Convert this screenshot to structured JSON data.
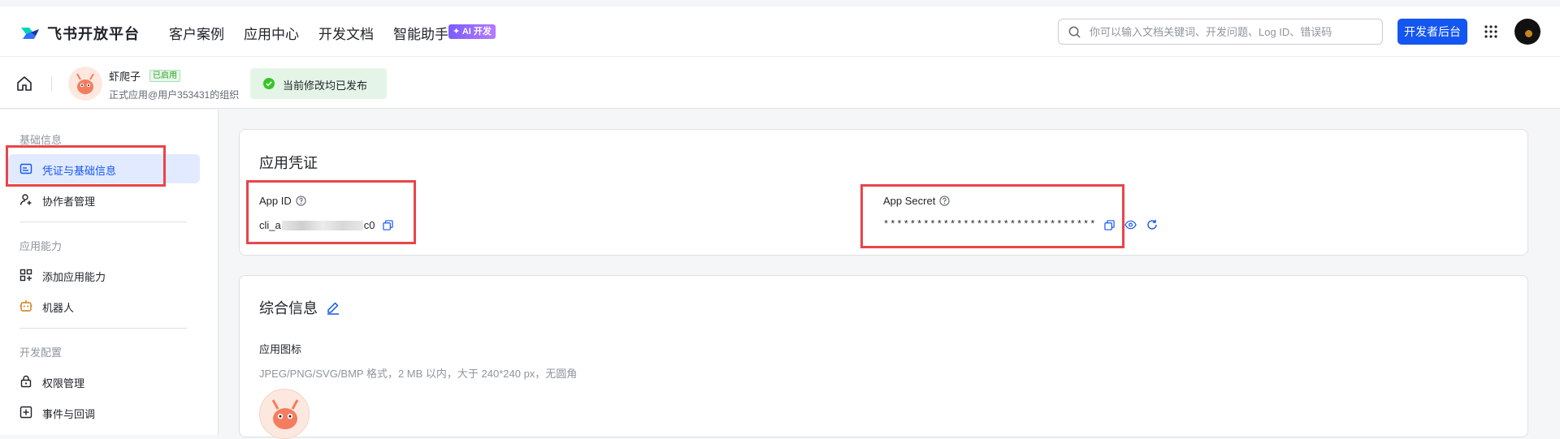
{
  "brand": {
    "name": "飞书开放平台"
  },
  "nav": {
    "items": [
      "客户案例",
      "应用中心",
      "开发文档",
      "智能助手"
    ],
    "ai_badge": "✦ AI 开发"
  },
  "search": {
    "placeholder": "你可以输入文档关键词、开发问题、Log ID、错误码",
    "value": ""
  },
  "dev_console_button": "开发者后台",
  "app": {
    "name": "虾爬子",
    "status_tag": "已启用",
    "org": "正式应用@用户353431的组织"
  },
  "publish_status": "当前修改均已发布",
  "sidebar": {
    "groups": [
      {
        "label": "基础信息",
        "items": [
          {
            "label": "凭证与基础信息",
            "icon": "id-card-icon",
            "active": true
          },
          {
            "label": "协作者管理",
            "icon": "user-add-icon",
            "active": false
          }
        ]
      },
      {
        "label": "应用能力",
        "items": [
          {
            "label": "添加应用能力",
            "icon": "grid-add-icon",
            "active": false
          },
          {
            "label": "机器人",
            "icon": "robot-icon",
            "active": false
          }
        ]
      },
      {
        "label": "开发配置",
        "items": [
          {
            "label": "权限管理",
            "icon": "lock-icon",
            "active": false
          },
          {
            "label": "事件与回调",
            "icon": "event-icon",
            "active": false
          }
        ]
      }
    ]
  },
  "credentials": {
    "title": "应用凭证",
    "app_id": {
      "label": "App ID",
      "prefix": "cli_a",
      "suffix": "c0"
    },
    "app_secret": {
      "label": "App Secret",
      "value": "********************************"
    }
  },
  "general_info": {
    "title": "综合信息",
    "icon_label": "应用图标",
    "icon_hint": "JPEG/PNG/SVG/BMP 格式，2 MB 以内，大于 240*240 px，无圆角"
  },
  "colors": {
    "primary": "#1456f0",
    "highlight": "#e8454a",
    "success": "#2ea121"
  }
}
